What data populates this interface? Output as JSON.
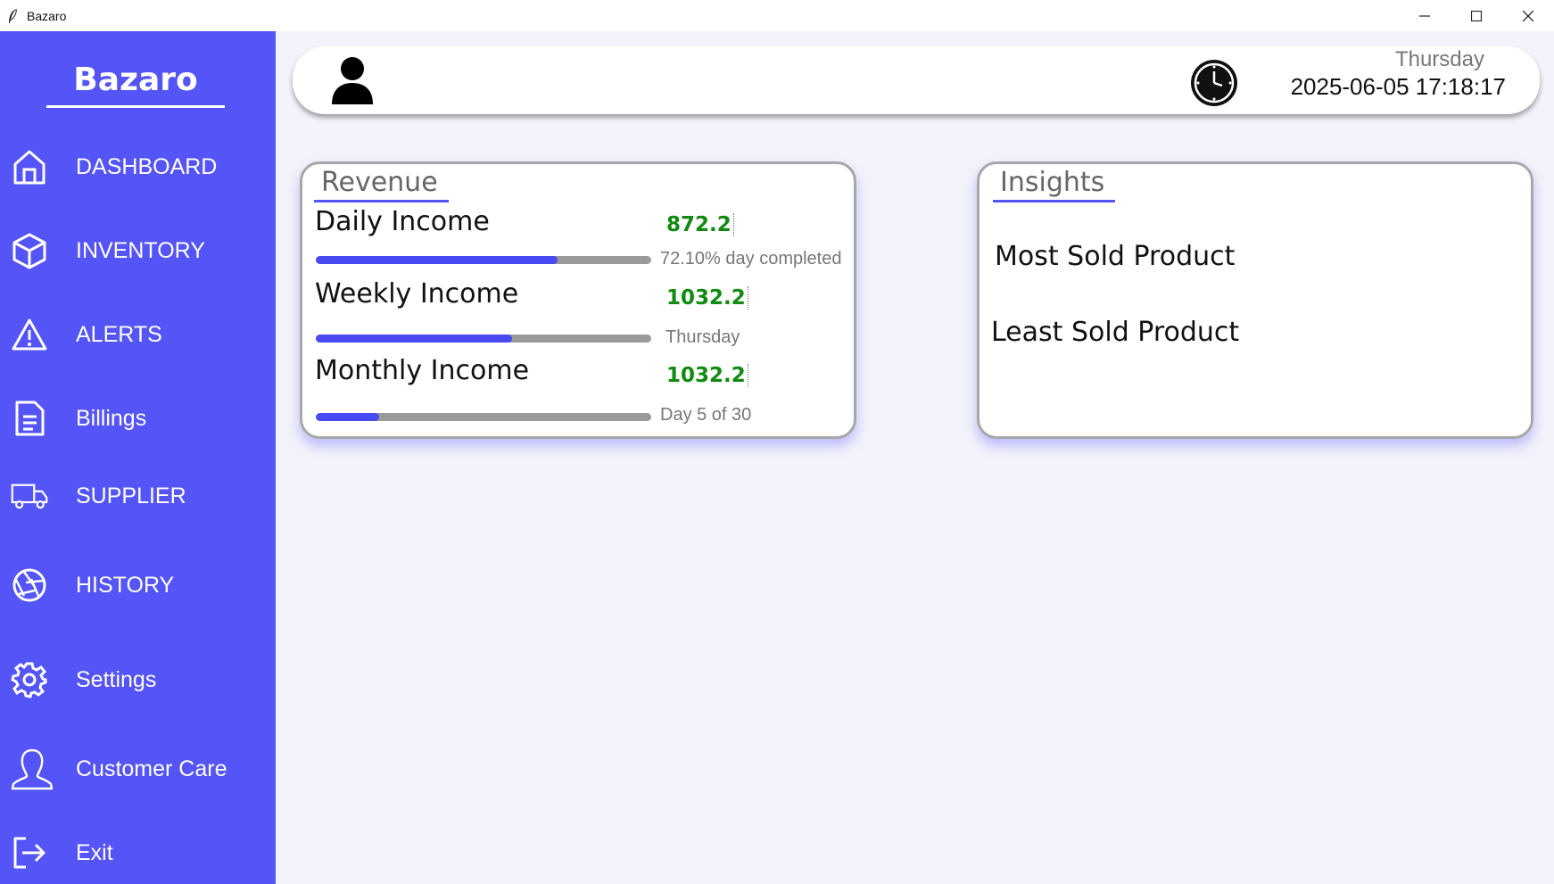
{
  "window": {
    "title": "Bazaro",
    "controls": [
      "minimize-icon",
      "maximize-icon",
      "close-icon"
    ]
  },
  "sidebar": {
    "brand": "Bazaro",
    "items": [
      {
        "label": "DASHBOARD",
        "icon": "home-icon"
      },
      {
        "label": "INVENTORY",
        "icon": "box-icon"
      },
      {
        "label": "ALERTS",
        "icon": "warning-icon"
      },
      {
        "label": "Billings",
        "icon": "document-icon"
      },
      {
        "label": "SUPPLIER",
        "icon": "truck-icon"
      },
      {
        "label": "HISTORY",
        "icon": "aperture-icon"
      },
      {
        "label": "Settings",
        "icon": "gear-icon"
      },
      {
        "label": "Customer Care",
        "icon": "person-outline-icon"
      },
      {
        "label": "Exit",
        "icon": "logout-icon"
      }
    ]
  },
  "header": {
    "avatar_icon": "user-icon",
    "clock_icon": "clock-icon",
    "day": "Thursday",
    "datetime": "2025-06-05 17:18:17"
  },
  "revenue": {
    "heading": "Revenue",
    "rows": [
      {
        "label": "Daily Income",
        "value": "872.2",
        "progress": 0.721,
        "caption": "72.10% day completed"
      },
      {
        "label": "Weekly Income",
        "value": "1032.2",
        "progress": 0.586,
        "caption": "Thursday"
      },
      {
        "label": "Monthly Income",
        "value": "1032.2",
        "progress": 0.19,
        "caption": "Day 5 of 30"
      }
    ]
  },
  "insights": {
    "heading": "Insights",
    "most_sold_label": "Most Sold Product",
    "least_sold_label": "Least Sold Product"
  },
  "colors": {
    "sidebar": "#5454f7",
    "accent": "#4a4af2",
    "income_value": "#108a10",
    "background": "#f3f3fb"
  }
}
